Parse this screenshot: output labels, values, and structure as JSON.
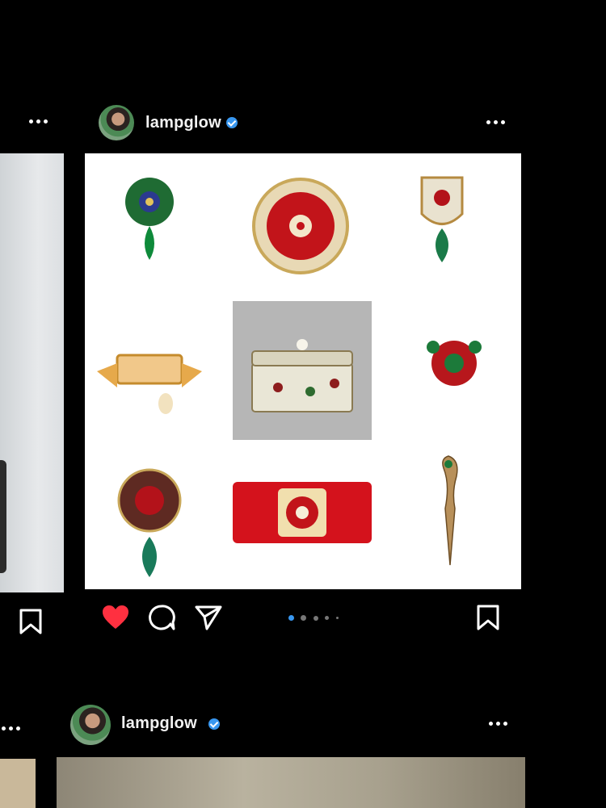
{
  "posts": [
    {
      "username": "lampglow",
      "verified": true,
      "liked": true,
      "carousel": {
        "current": 1,
        "total": 5
      }
    },
    {
      "username": "lampglow",
      "verified": true
    }
  ],
  "icons": {
    "more": "more-options-icon",
    "like": "heart-icon",
    "comment": "comment-icon",
    "share": "send-icon",
    "save": "bookmark-icon"
  },
  "colors": {
    "background": "#000000",
    "like": "#ff3040",
    "verified": "#3897f0",
    "active_dot": "#3897f0"
  }
}
